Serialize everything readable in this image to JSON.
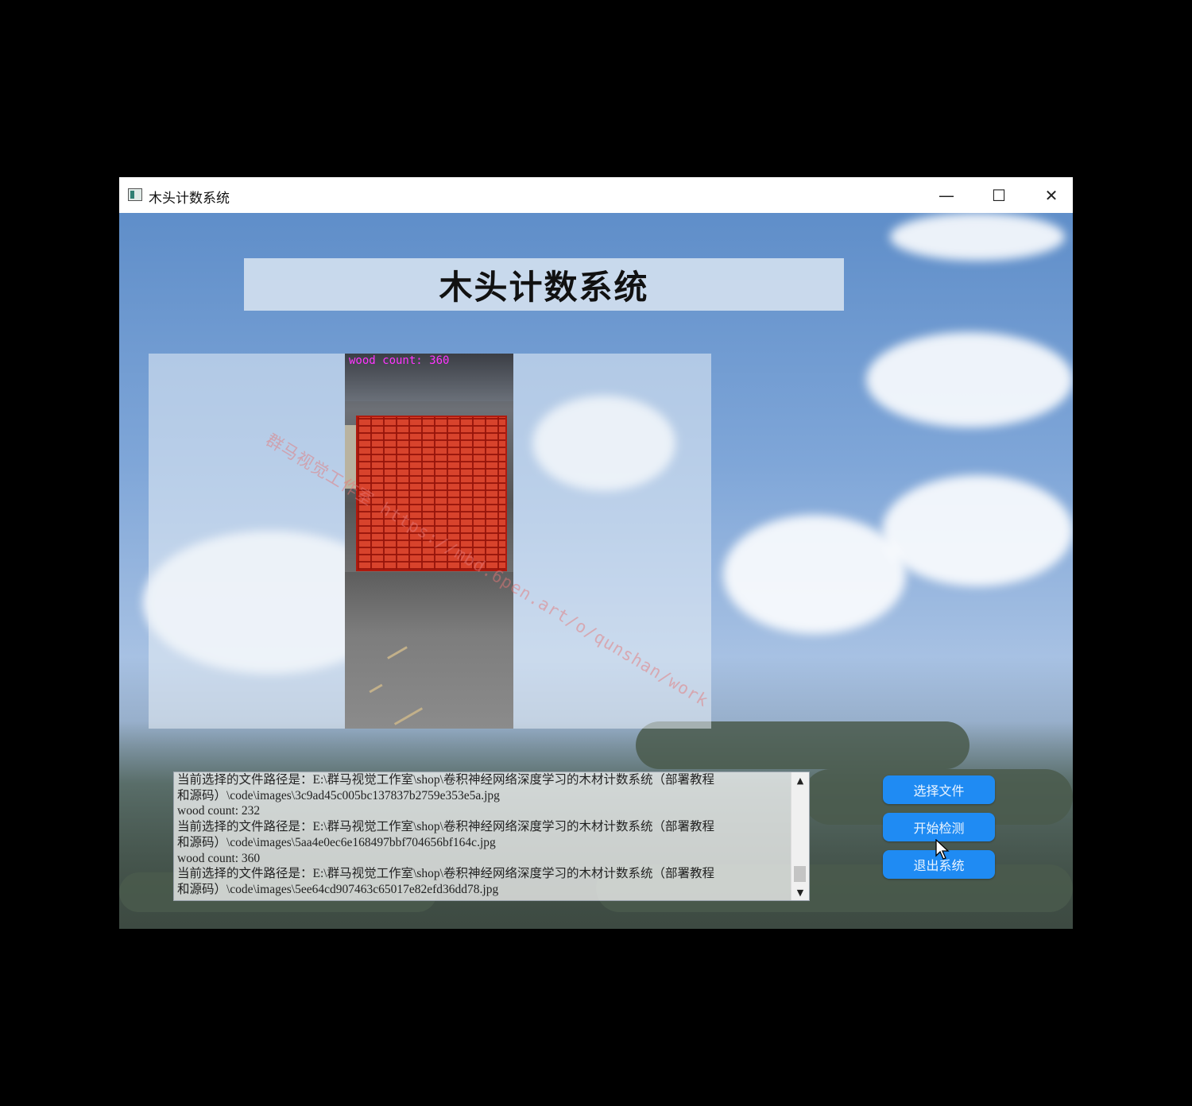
{
  "window": {
    "title": "木头计数系统",
    "controls": {
      "minimize": "—",
      "maximize": "☐",
      "close": "✕"
    }
  },
  "header": {
    "title": "木头计数系统"
  },
  "detection": {
    "label": "wood count: 360",
    "watermark": "群马视觉工作室 https://mbd.6pen.art/o/qunshan/work"
  },
  "log": {
    "lines": [
      "当前选择的文件路径是：E:\\群马视觉工作室\\shop\\卷积神经网络深度学习的木材计数系统（部署教程",
      "和源码）\\code\\images\\3c9ad45c005bc137837b2759e353e5a.jpg",
      "wood count: 232",
      "当前选择的文件路径是：E:\\群马视觉工作室\\shop\\卷积神经网络深度学习的木材计数系统（部署教程",
      "和源码）\\code\\images\\5aa4e0ec6e168497bbf704656bf164c.jpg",
      "wood count: 360",
      "当前选择的文件路径是：E:\\群马视觉工作室\\shop\\卷积神经网络深度学习的木材计数系统（部署教程",
      "和源码）\\code\\images\\5ee64cd907463c65017e82efd36dd78.jpg"
    ],
    "scroll_up": "▲",
    "scroll_down": "▼"
  },
  "buttons": {
    "select_file": "选择文件",
    "start_detect": "开始检测",
    "exit": "退出系统"
  },
  "icons": [
    "app-icon",
    "minimize-icon",
    "maximize-icon",
    "close-icon",
    "cursor-icon"
  ],
  "colors": {
    "button": "#1f8bf3",
    "label": "#ff35ff",
    "boxes": "#d8432c"
  }
}
